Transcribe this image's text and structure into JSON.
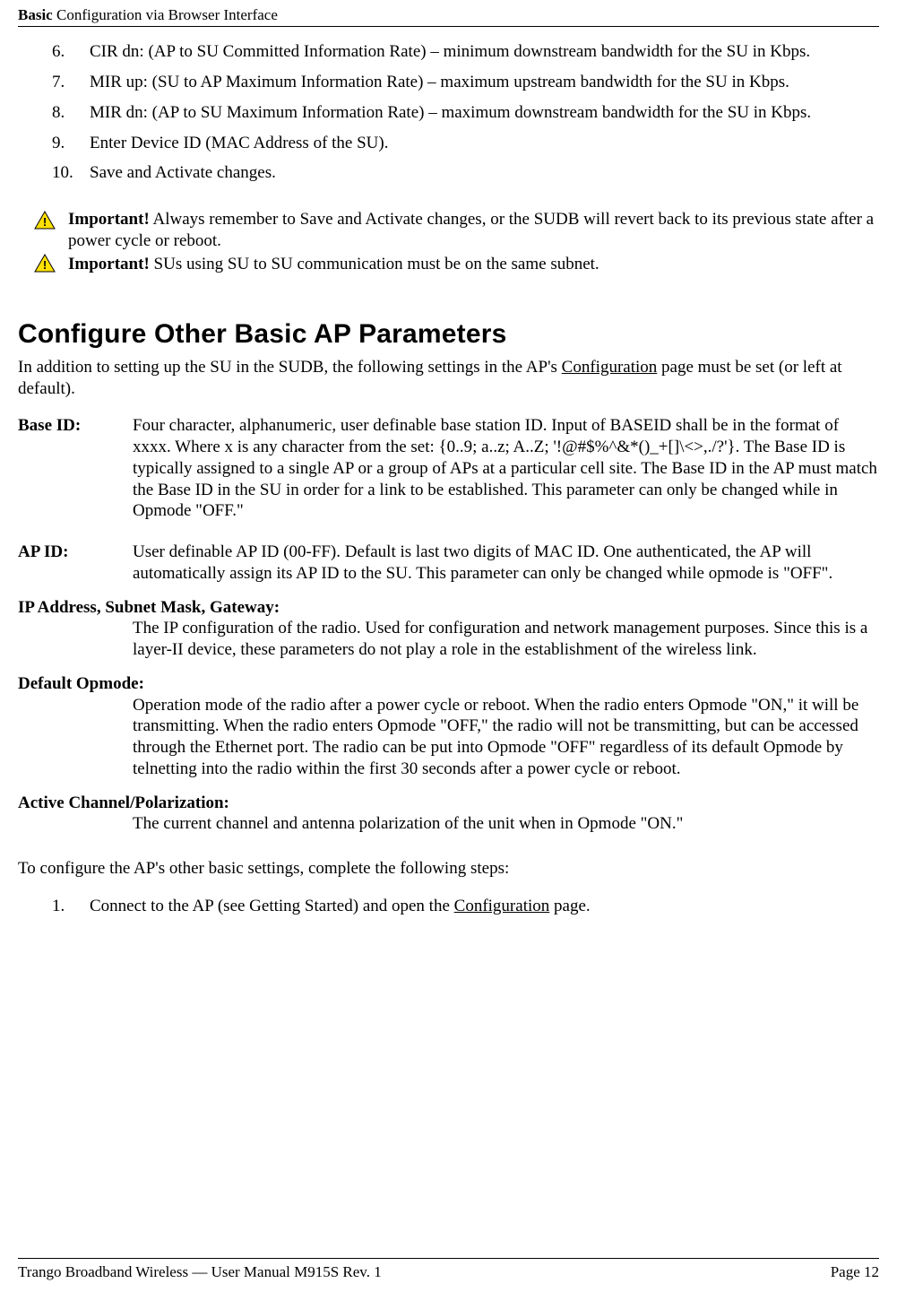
{
  "header": {
    "title_bold": "Basic",
    "title_rest": " Configuration via Browser Interface"
  },
  "steps": [
    "CIR dn: (AP to SU Committed Information Rate) – minimum downstream bandwidth for the SU in Kbps.",
    "MIR up: (SU to AP Maximum Information Rate) – maximum upstream bandwidth for the SU in Kbps.",
    "MIR dn: (AP to SU Maximum Information Rate) – maximum downstream bandwidth for the SU in Kbps.",
    "Enter Device ID (MAC Address of the SU).",
    "Save and Activate changes."
  ],
  "important": [
    {
      "lead": "Important!",
      "text": "  Always remember to Save and Activate changes, or the SUDB will revert back to its previous state after a power cycle or reboot."
    },
    {
      "lead": "Important!",
      "text": "  SUs using SU to SU communication must be on the same subnet."
    }
  ],
  "section_title": "Configure Other Basic AP Parameters",
  "section_intro_pre": "In addition to setting up the SU in the SUDB, the following settings in the AP's ",
  "section_intro_link": "Configuration",
  "section_intro_post": " page must be set (or left at default).",
  "defs": {
    "base_id_label": "Base ID:",
    "base_id_body": "Four character, alphanumeric, user definable base station ID.  Input of BASEID shall be in the format of xxxx.  Where x is any character from the set: {0..9; a..z; A..Z; '!@#$%^&*()_+[]\\<>,./?'}.  The Base ID is typically assigned to a single AP or a group of APs at a particular cell site.  The Base ID in the AP must match the Base ID in the SU in order for a link to be established.  This parameter can only be changed while in Opmode \"OFF.\"",
    "ap_id_label": "AP ID:",
    "ap_id_body": "User definable AP ID (00-FF).  Default is last two digits of MAC ID.  One authenticated, the AP will automatically assign its AP ID to the SU.  This parameter can only be changed while opmode is \"OFF\".",
    "ip_label": "IP Address, Subnet Mask, Gateway:",
    "ip_body": "The IP configuration of the radio.  Used for configuration and network management purposes.  Since this is a layer-II device, these parameters do not play a role in the establishment of the wireless link.",
    "dop_label": "Default Opmode:",
    "dop_body": "Operation mode of the radio after a power cycle or reboot.  When the radio enters Opmode \"ON,\" it will be transmitting.  When the radio enters Opmode \"OFF,\" the radio will not be transmitting, but can be accessed through the Ethernet port.  The radio can be put into Opmode \"OFF\" regardless of its default Opmode by telnetting into the radio within the first 30 seconds after a power cycle or reboot.",
    "ac_label": "Active Channel/Polarization:",
    "ac_body": "The current channel and antenna polarization of the unit when in Opmode \"ON.\""
  },
  "configure_intro": "To configure the AP's other basic settings, complete the following steps:",
  "configure_step_pre": "Connect to the AP (see Getting Started) and open the ",
  "configure_step_link": "Configuration",
  "configure_step_post": " page.",
  "footer": {
    "left": "Trango Broadband Wireless — User Manual M915S Rev. 1",
    "right": "Page 12"
  }
}
